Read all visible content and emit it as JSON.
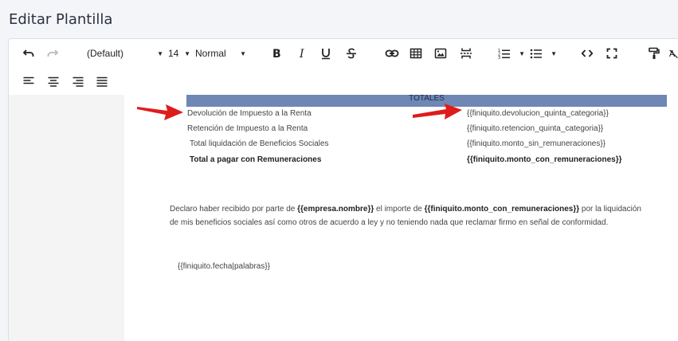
{
  "page": {
    "title": "Editar Plantilla"
  },
  "toolbar": {
    "font_family": "(Default)",
    "font_size": "14",
    "paragraph_style": "Normal"
  },
  "document": {
    "totales_header": "TOTALES",
    "rows": [
      {
        "label": "Devolución de Impuesto a la Renta",
        "value": "{{finiquito.devolucion_quinta_categoria}}",
        "bold": false
      },
      {
        "label": "Retención de Impuesto a la Renta",
        "value": "{{finiquito.retencion_quinta_categoria}}",
        "bold": false
      },
      {
        "label": "Total liquidación de Beneficios Sociales",
        "value": "{{finiquito.monto_sin_remuneraciones}}",
        "bold": false
      },
      {
        "label": "Total a pagar con Remuneraciones",
        "value": "{{finiquito.monto_con_remuneraciones}}",
        "bold": true
      }
    ],
    "declaration": {
      "part1": "Declaro haber recibido por parte de ",
      "empresa": "{{empresa.nombre}}",
      "part2": "  el importe de ",
      "monto": "{{finiquito.monto_con_remuneraciones}}",
      "part3": " por la liquidación",
      "line2": "de mis beneficios sociales así como otros de acuerdo a ley y no teniendo nada que reclamar firmo en señal de conformidad."
    },
    "fecha": "{{finiquito.fecha|palabras}}"
  },
  "colors": {
    "arrow": "#e01b1b",
    "totales_bar": "#6e87b4"
  }
}
